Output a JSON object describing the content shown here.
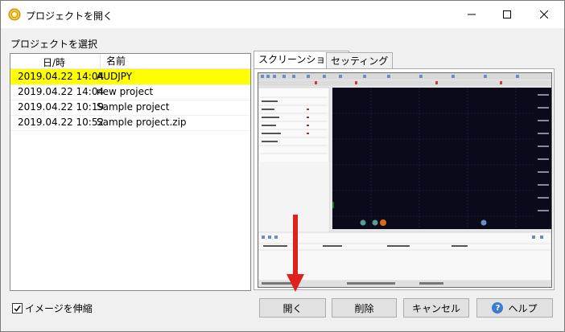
{
  "window": {
    "title": "プロジェクトを開く"
  },
  "project_list": {
    "label": "プロジェクトを選択",
    "columns": [
      "日/時",
      "名前"
    ],
    "rows": [
      {
        "date": "2019.04.22 14:04",
        "name": "AUDJPY",
        "selected": true
      },
      {
        "date": "2019.04.22 14:04",
        "name": "new project",
        "selected": false
      },
      {
        "date": "2019.04.22 10:19",
        "name": "Sample project",
        "selected": false
      },
      {
        "date": "2019.04.22 10:52",
        "name": "Sample project.zip",
        "selected": false
      }
    ]
  },
  "tabs": [
    {
      "label": "スクリーンショット",
      "active": true
    },
    {
      "label": "セッティング",
      "active": false
    }
  ],
  "stretch_image": {
    "label": "イメージを伸縮",
    "checked": true
  },
  "buttons": {
    "open": "開く",
    "delete": "削除",
    "cancel": "キャンセル",
    "help": "ヘルプ"
  },
  "colors": {
    "selection": "#ffff00",
    "arrow": "#e0201c",
    "chart_bg": "#0a0a1a"
  }
}
